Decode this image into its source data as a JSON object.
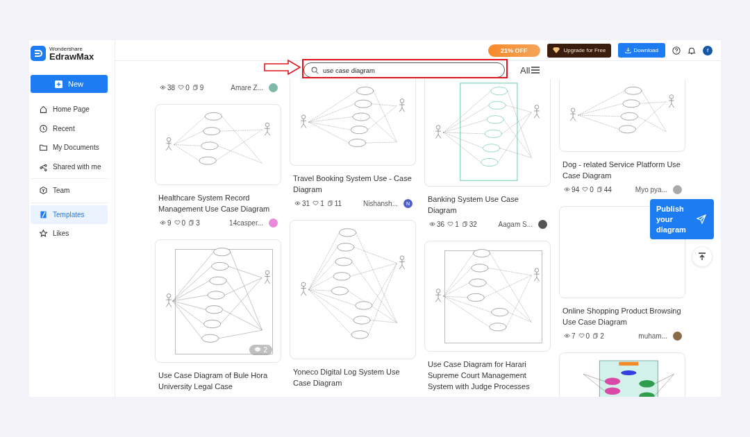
{
  "logo": {
    "brand": "Wondershare",
    "product": "EdrawMax"
  },
  "sidebar": {
    "new_button": "New",
    "items": [
      {
        "label": "Home Page",
        "selected": false
      },
      {
        "label": "Recent",
        "selected": false
      },
      {
        "label": "My Documents",
        "selected": false
      },
      {
        "label": "Shared with me",
        "selected": false
      },
      {
        "label": "Team",
        "selected": false
      },
      {
        "label": "Templates",
        "selected": true
      },
      {
        "label": "Likes",
        "selected": false
      }
    ]
  },
  "topbar": {
    "promo": "21% OFF",
    "upgrade": "Upgrade for Free",
    "download": "Download",
    "avatar": "f"
  },
  "search": {
    "value": "use case diagram",
    "filter": "All"
  },
  "columns": [
    [
      {
        "views": "38",
        "likes": "0",
        "copies": "9",
        "author": "Amare Z...",
        "color": "#7fb8a8"
      },
      {
        "thumbnail": {
          "kind": "plain"
        },
        "title": "Healthcare System Record Management Use Case Diagram",
        "views": "9",
        "likes": "0",
        "copies": "3",
        "author": "14casper...",
        "color": "#e88ad8"
      },
      {
        "thumbnail": {
          "kind": "dense",
          "badge": "2"
        },
        "title": "Use Case Diagram of Bule Hora University Legal Case"
      }
    ],
    [
      {
        "thumbnail": {
          "kind": "plain"
        },
        "title": "Travel Booking System Use - Case Diagram",
        "views": "31",
        "likes": "1",
        "copies": "11",
        "author": "Nishansh...",
        "color": "#4f5fc8",
        "avatar_letter": "N"
      },
      {
        "thumbnail": {
          "kind": "plain"
        },
        "title": "Yoneco Digital Log System Use Case Diagram"
      }
    ],
    [
      {
        "thumbnail": {
          "kind": "green"
        },
        "title": "Banking System Use Case Diagram",
        "views": "36",
        "likes": "1",
        "copies": "32",
        "author": "Aagam S...",
        "color": "#555555"
      },
      {
        "thumbnail": {
          "kind": "boxed"
        },
        "title": "Use Case Diagram for Harari Supreme Court Management System with Judge Processes"
      }
    ],
    [
      {
        "thumbnail": {
          "kind": "plain"
        },
        "title": "Dog - related Service Platform Use Case Diagram",
        "views": "94",
        "likes": "0",
        "copies": "44",
        "author": "Myo pya...",
        "color": "#a9a9a9"
      },
      {
        "thumbnail": {
          "kind": "blank"
        },
        "title": "Online Shopping Product Browsing Use Case Diagram",
        "views": "7",
        "likes": "0",
        "copies": "2",
        "author": "muham...",
        "color": "#8a6a4a"
      },
      {
        "thumbnail": {
          "kind": "color"
        }
      }
    ]
  ],
  "publish_button": "Publish your diagram"
}
